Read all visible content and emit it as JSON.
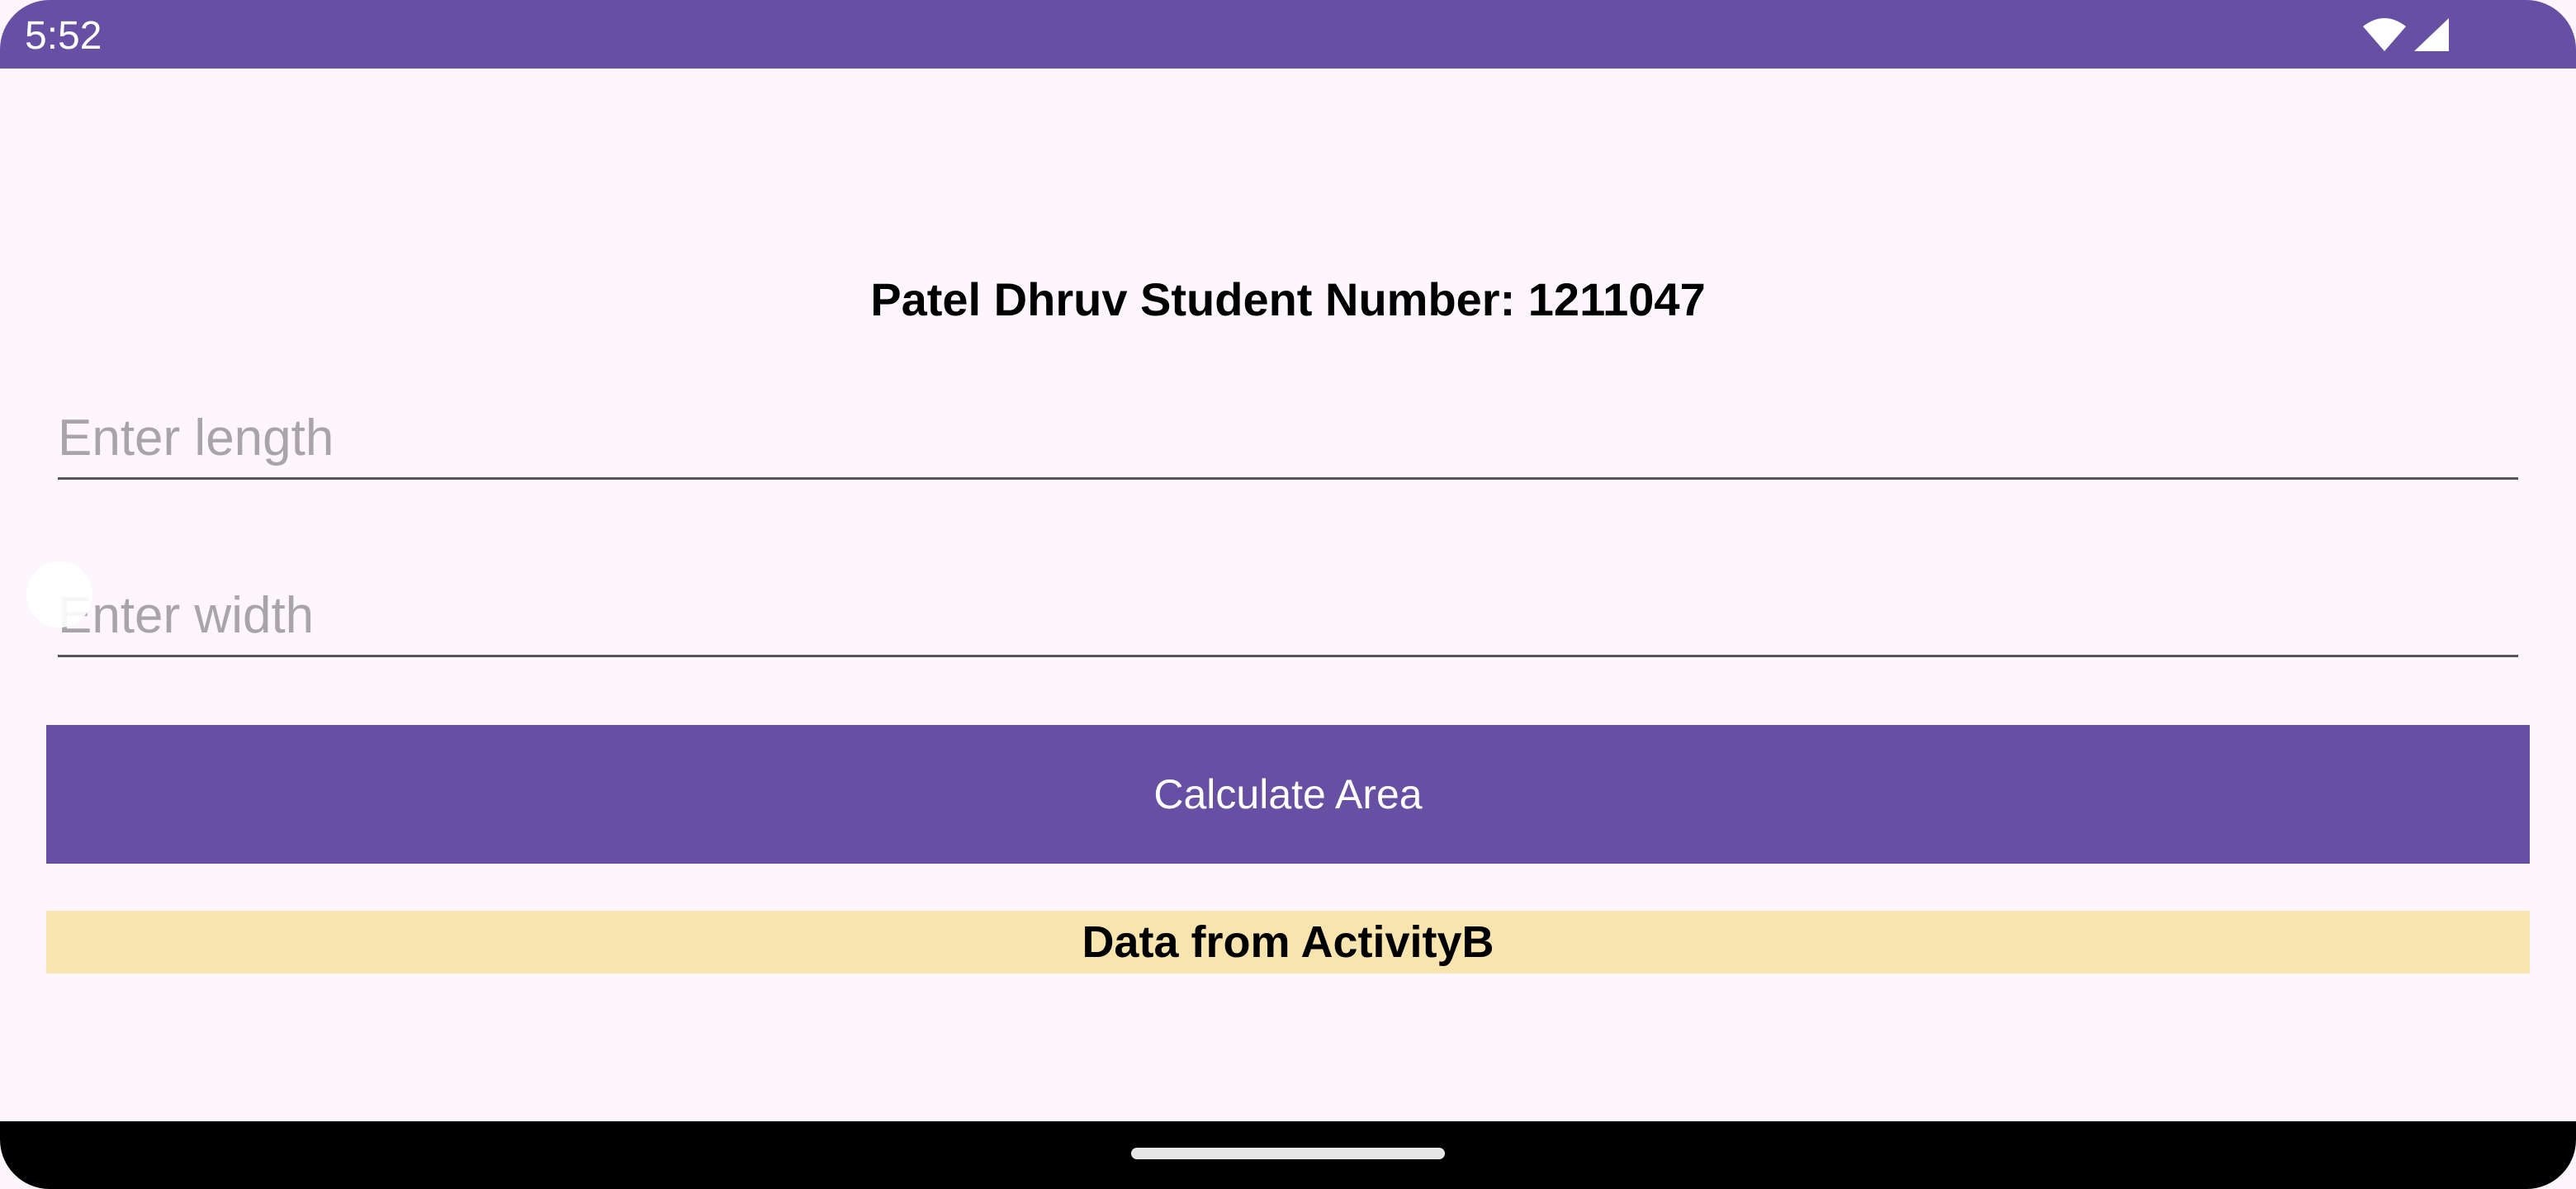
{
  "status_bar": {
    "time": "5:52",
    "icons": [
      "wifi-icon",
      "signal-icon"
    ],
    "color": "#6750a4"
  },
  "main": {
    "title": "Patel Dhruv Student Number: 1211047",
    "length_field": {
      "value": "",
      "placeholder": "Enter length"
    },
    "width_field": {
      "value": "",
      "placeholder": "Enter width"
    },
    "calculate_button_label": "Calculate Area",
    "data_banner_text": "Data from ActivityB",
    "accent_color": "#6750a4",
    "banner_color": "#f8e4ae"
  },
  "navigation_bar": {
    "icons": [
      "home-handle"
    ]
  }
}
